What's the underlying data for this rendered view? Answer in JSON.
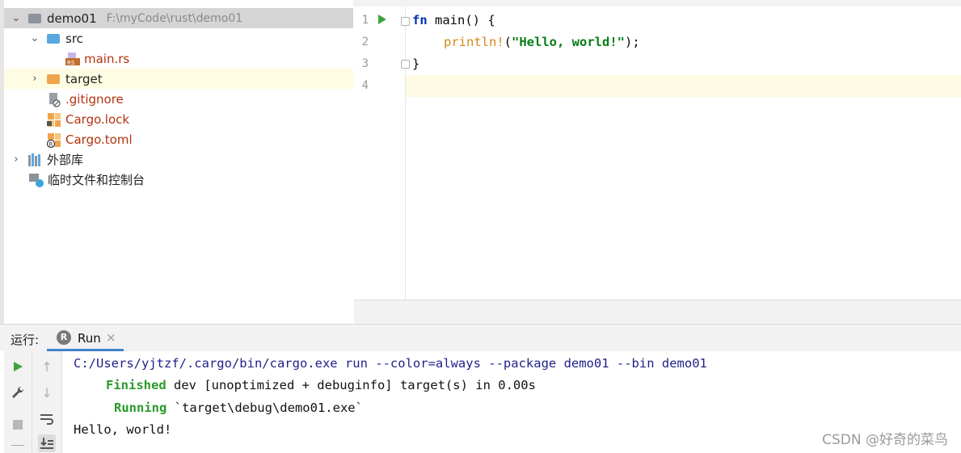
{
  "project_tree": {
    "root": {
      "name": "demo01",
      "path": "F:\\myCode\\rust\\demo01",
      "expanded": true
    },
    "items": [
      {
        "label": "src",
        "icon": "folder-icon",
        "expanded": true
      },
      {
        "label": "main.rs",
        "icon": "rust-file-icon"
      },
      {
        "label": "target",
        "icon": "excluded-folder-icon",
        "expanded": false
      },
      {
        "label": ".gitignore",
        "icon": "ignore-file-icon"
      },
      {
        "label": "Cargo.lock",
        "icon": "lock-file-icon"
      },
      {
        "label": "Cargo.toml",
        "icon": "toml-file-icon"
      }
    ],
    "external_libraries": "外部库",
    "scratches": "临时文件和控制台"
  },
  "editor": {
    "line_numbers": [
      "1",
      "2",
      "3",
      "4"
    ],
    "code": {
      "l1_kw": "fn",
      "l1_rest": " main() {",
      "l2_macro": "println!",
      "l2_open": "(",
      "l2_str": "\"Hello, world!\"",
      "l2_close": ");",
      "l3": "}"
    }
  },
  "run_panel": {
    "prefix": "运行:",
    "tab_label": "Run",
    "tab_badge": "R",
    "console": {
      "command": "C:/Users/yjtzf/.cargo/bin/cargo.exe run --color=always --package demo01 --bin demo01",
      "finished_word": "Finished",
      "finished_rest": " dev [unoptimized + debuginfo] target(s) in 0.00s",
      "running_word": "Running",
      "running_rest": " `target\\debug\\demo01.exe`",
      "output": "Hello, world!"
    }
  },
  "watermark": "CSDN @好奇的菜鸟",
  "colors": {
    "keyword": "#0033b3",
    "string": "#067d17",
    "macro": "#d08a1c",
    "green_status": "#2b9a2b",
    "tab_underline": "#4083c9"
  }
}
